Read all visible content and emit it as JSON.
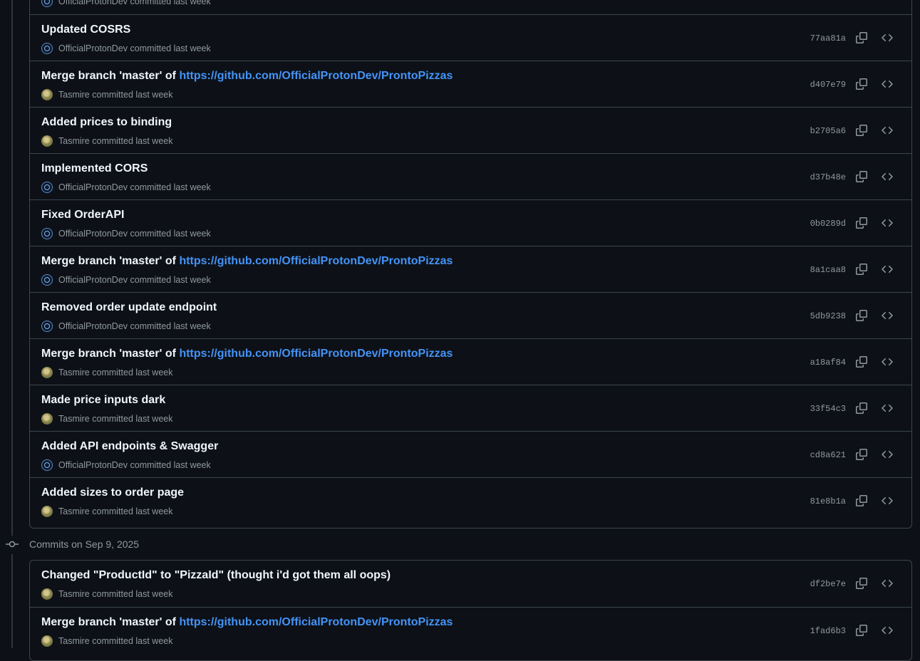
{
  "top_partial": {
    "author": "OfficialProtonDev",
    "suffix": "committed last week"
  },
  "groups": [
    {
      "commits": [
        {
          "message": "Updated COSRS",
          "link": "",
          "author": "OfficialProtonDev",
          "avatar": "proton-avatar",
          "suffix": "committed last week",
          "sha": "77aa81a"
        },
        {
          "message": "Merge branch 'master' of ",
          "link": "https://github.com/OfficialProtonDev/ProntoPizzas",
          "author": "Tasmire",
          "avatar": "tasmire-avatar",
          "suffix": "committed last week",
          "sha": "d407e79"
        },
        {
          "message": "Added prices to binding",
          "link": "",
          "author": "Tasmire",
          "avatar": "tasmire-avatar",
          "suffix": "committed last week",
          "sha": "b2705a6"
        },
        {
          "message": "Implemented CORS",
          "link": "",
          "author": "OfficialProtonDev",
          "avatar": "proton-avatar",
          "suffix": "committed last week",
          "sha": "d37b48e"
        },
        {
          "message": "Fixed OrderAPI",
          "link": "",
          "author": "OfficialProtonDev",
          "avatar": "proton-avatar",
          "suffix": "committed last week",
          "sha": "0b0289d"
        },
        {
          "message": "Merge branch 'master' of ",
          "link": "https://github.com/OfficialProtonDev/ProntoPizzas",
          "author": "OfficialProtonDev",
          "avatar": "proton-avatar",
          "suffix": "committed last week",
          "sha": "8a1caa8"
        },
        {
          "message": "Removed order update endpoint",
          "link": "",
          "author": "OfficialProtonDev",
          "avatar": "proton-avatar",
          "suffix": "committed last week",
          "sha": "5db9238"
        },
        {
          "message": "Merge branch 'master' of ",
          "link": "https://github.com/OfficialProtonDev/ProntoPizzas",
          "author": "Tasmire",
          "avatar": "tasmire-avatar",
          "suffix": "committed last week",
          "sha": "a18af84"
        },
        {
          "message": "Made price inputs dark",
          "link": "",
          "author": "Tasmire",
          "avatar": "tasmire-avatar",
          "suffix": "committed last week",
          "sha": "33f54c3"
        },
        {
          "message": "Added API endpoints & Swagger",
          "link": "",
          "author": "OfficialProtonDev",
          "avatar": "proton-avatar",
          "suffix": "committed last week",
          "sha": "cd8a621"
        },
        {
          "message": "Added sizes to order page",
          "link": "",
          "author": "Tasmire",
          "avatar": "tasmire-avatar",
          "suffix": "committed last week",
          "sha": "81e8b1a"
        }
      ]
    },
    {
      "heading": "Commits on Sep 9, 2025",
      "commits": [
        {
          "message": "Changed \"ProductId\" to \"PizzaId\" (thought i'd got them all oops)",
          "link": "",
          "author": "Tasmire",
          "avatar": "tasmire-avatar",
          "suffix": "committed last week",
          "sha": "df2be7e"
        },
        {
          "message": "Merge branch 'master' of ",
          "link": "https://github.com/OfficialProtonDev/ProntoPizzas",
          "author": "Tasmire",
          "avatar": "tasmire-avatar",
          "suffix": "committed last week",
          "sha": "1fad6b3"
        }
      ]
    }
  ],
  "icons": {
    "copy": "copy-icon",
    "browse": "code-icon",
    "commit": "git-commit-icon"
  },
  "colors": {
    "background": "#0d1117",
    "border": "#3d444d",
    "text": "#f0f6fc",
    "muted": "#9198a1",
    "link": "#4493f8"
  }
}
